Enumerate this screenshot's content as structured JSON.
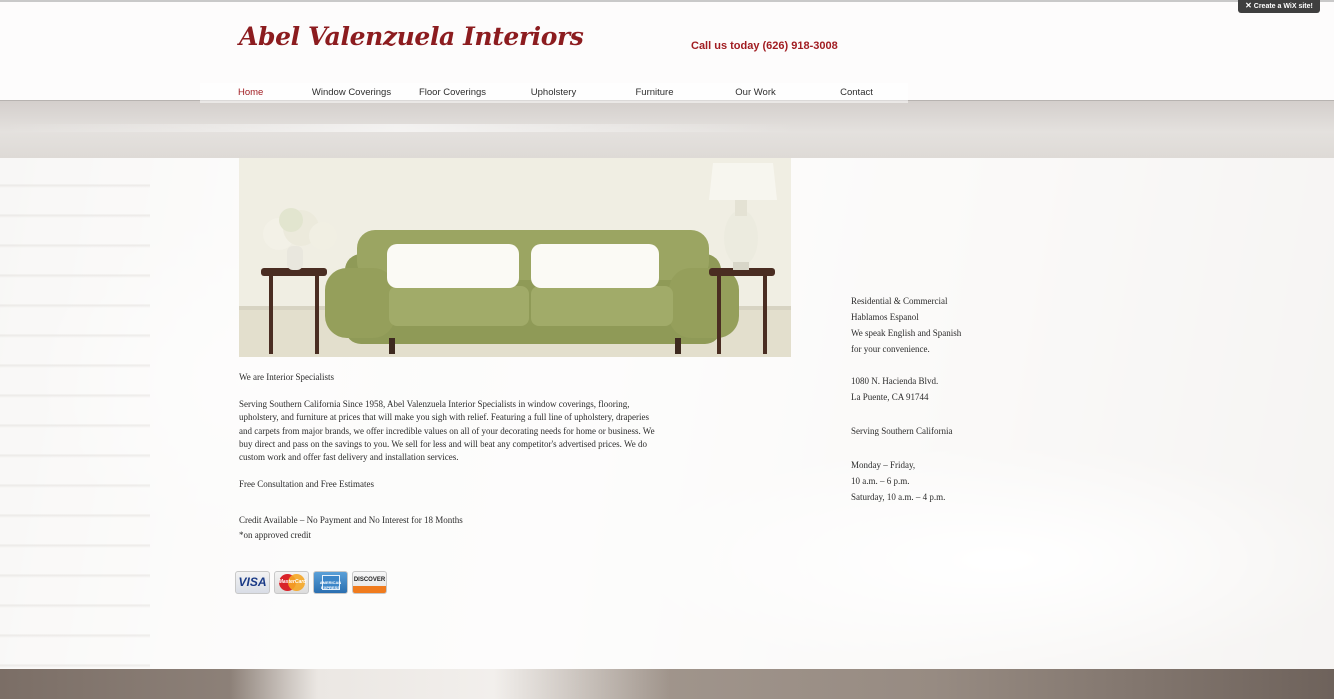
{
  "wix_badge": {
    "label": "Create a WiX site!"
  },
  "header": {
    "site_title": "Abel Valenzuela Interiors",
    "phone": "Call us today (626) 918-3008"
  },
  "nav": {
    "items": [
      {
        "label": "Home",
        "active": true
      },
      {
        "label": "Window Coverings"
      },
      {
        "label": "Floor Coverings"
      },
      {
        "label": "Upholstery"
      },
      {
        "label": "Furniture"
      },
      {
        "label": "Our Work"
      },
      {
        "label": "Contact"
      }
    ]
  },
  "main": {
    "heading": "We are Interior Specialists",
    "paragraph": "Serving Southern California Since 1958, Abel Valenzuela Interior Specialists in window coverings, flooring, upholstery, and furniture at prices that will make you sigh with relief. Featuring a full line of upholstery, draperies and carpets from major brands, we offer incredible values on all of your decorating needs for home or business. We buy direct and pass on the savings to you. We sell for less and will beat any competitor's advertised prices. We do custom work and offer fast delivery and installation services.",
    "consultation": "Free Consultation and Free Estimates",
    "credit_line": "Credit Available – No Payment and No Interest for 18 Months",
    "credit_note": "*on approved credit"
  },
  "cards": {
    "visa": "VISA",
    "mastercard": "MasterCard",
    "amex": "AMERICAN EXPRESS",
    "discover": "DISCOVER"
  },
  "side": {
    "line1": "Residential & Commercial",
    "line2": "Hablamos Espanol",
    "line3": "We speak English and Spanish",
    "line4": "for your convenience.",
    "address1": "1080 N. Hacienda Blvd.",
    "address2": "La Puente, CA 91744",
    "region": "Serving Southern California",
    "hours1": "Monday – Friday,",
    "hours2": "10 a.m. – 6 p.m.",
    "hours3": "Saturday, 10 a.m. – 4 p.m."
  },
  "colors": {
    "brand": "#8c1c1f",
    "accent": "#a11d22",
    "text": "#2c2c2c"
  }
}
